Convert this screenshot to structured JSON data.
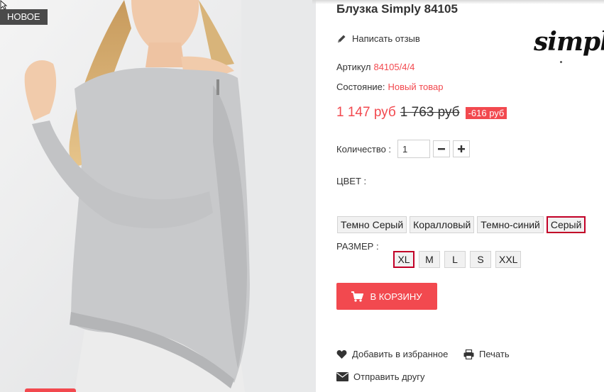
{
  "product": {
    "badge": "Новое",
    "title": "Блузка Simply 84105",
    "brand_logo_text": "simply",
    "review_link": "Написать отзыв",
    "sku_label": "Артикул",
    "sku_value": "84105/4/4",
    "condition_label": "Состояние:",
    "condition_value": "Новый товар",
    "price_current": "1 147 руб",
    "price_old": "1 763 руб",
    "price_discount": "-616 руб",
    "quantity_label": "Количество :",
    "quantity_value": "1",
    "color_label": "ЦВЕТ :",
    "colors": [
      "Темно Серый",
      "Коралловый",
      "Темно-синий",
      "Серый"
    ],
    "selected_color": "Серый",
    "size_label": "РАЗМЕР :",
    "sizes": [
      "XL",
      "M",
      "L",
      "S",
      "XXL"
    ],
    "selected_size": "XL",
    "cart_button": "В корзину",
    "wishlist_link": "Добавить в избранное",
    "print_link": "Печать",
    "send_friend_link": "Отправить другу"
  },
  "colors": {
    "accent": "#f2494f",
    "selected_border": "#c20027",
    "badge_bg": "#4a4a4a"
  },
  "icons": {
    "review": "pencil-icon",
    "qty_minus": "minus-icon",
    "qty_plus": "plus-icon",
    "cart": "cart-icon",
    "wishlist": "heart-icon",
    "print": "printer-icon",
    "send": "envelope-icon"
  }
}
